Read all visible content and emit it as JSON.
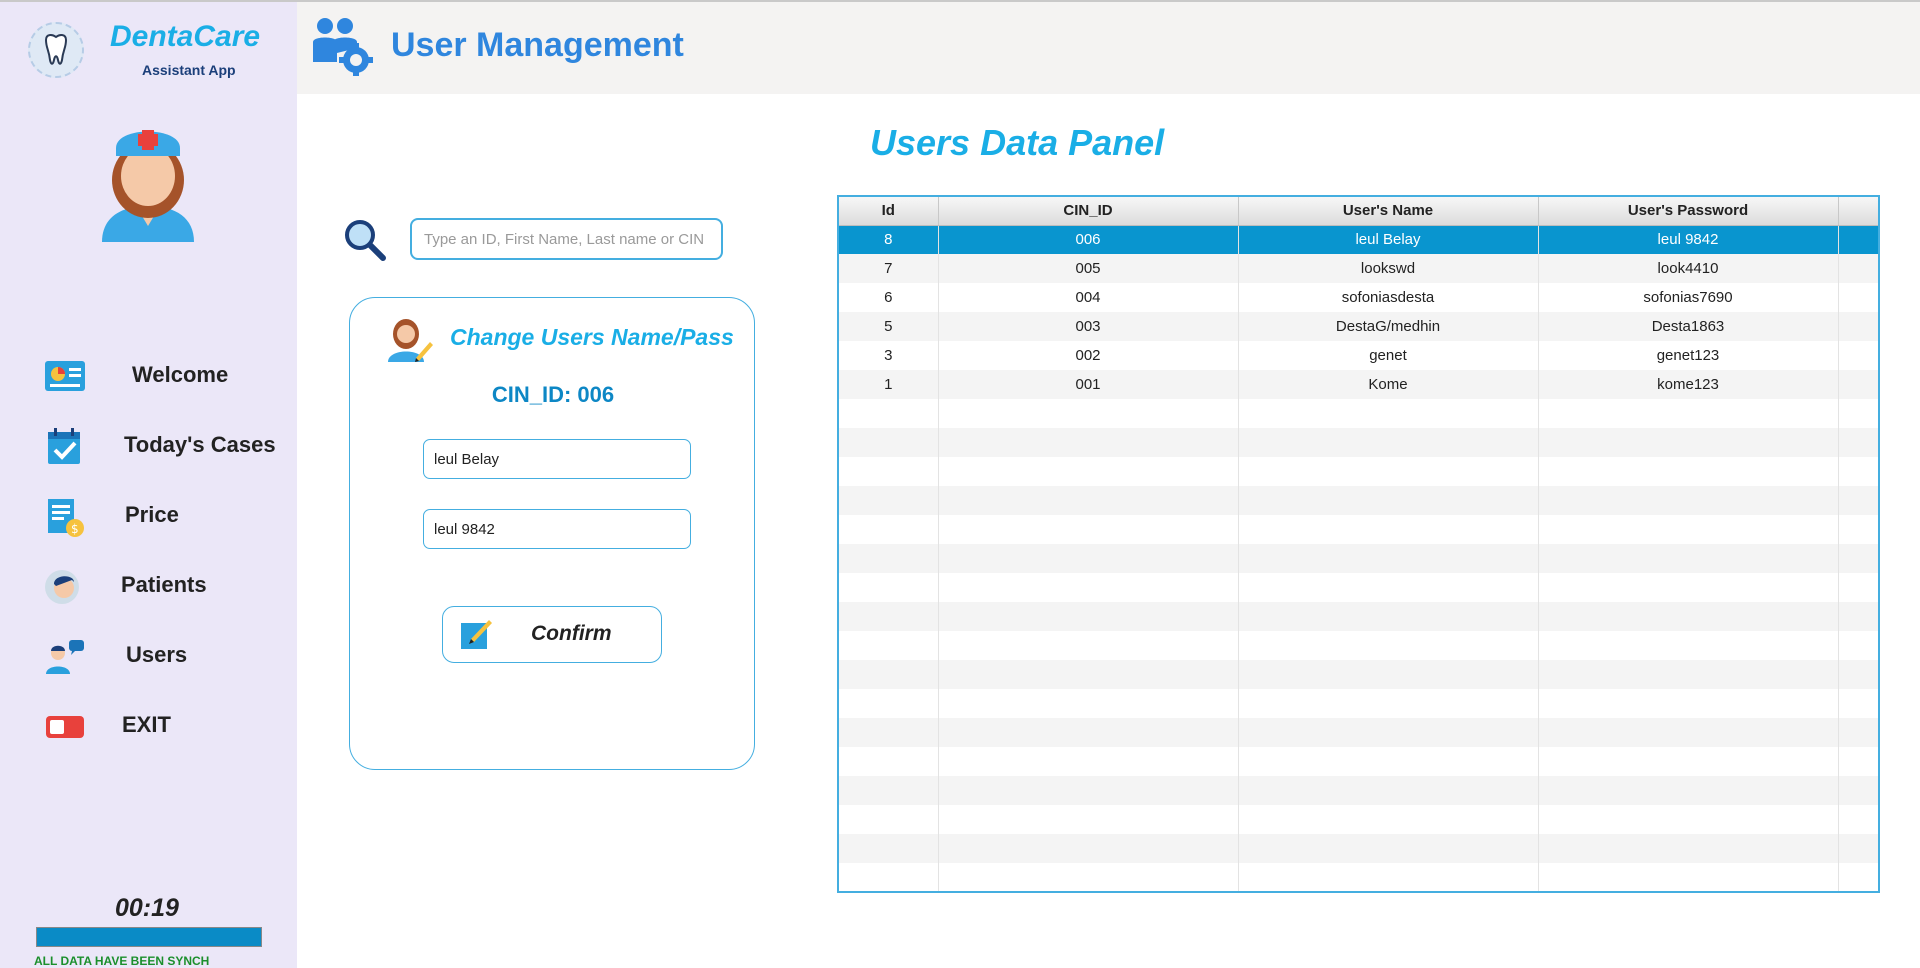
{
  "brand": {
    "name": "DentaCare",
    "subtitle": "Assistant App"
  },
  "nav": [
    {
      "label": "Welcome",
      "icon": "dashboard-icon"
    },
    {
      "label": "Today's Cases",
      "icon": "calendar-check-icon"
    },
    {
      "label": "Price",
      "icon": "invoice-icon"
    },
    {
      "label": "Patients",
      "icon": "patient-icon"
    },
    {
      "label": "Users",
      "icon": "user-chat-icon"
    },
    {
      "label": "EXIT",
      "icon": "toggle-exit-icon"
    }
  ],
  "status": {
    "timer": "00:19",
    "progress": 1.0,
    "sync_text": "ALL DATA HAVE BEEN SYNCH"
  },
  "header": {
    "title": "User Management",
    "icon": "users-gear-icon"
  },
  "panel": {
    "title": "Users Data Panel"
  },
  "search": {
    "placeholder": "Type an ID, First Name, Last name or CIN",
    "value": ""
  },
  "edit_card": {
    "title": "Change Users Name/Pass",
    "cin_label": "CIN_ID: 006",
    "name_value": "leul Belay",
    "password_value": "leul 9842",
    "confirm_label": "Confirm"
  },
  "table": {
    "columns": [
      "Id",
      "CIN_ID",
      "User's Name",
      "User's Password"
    ],
    "rows": [
      [
        "8",
        "006",
        "leul Belay",
        "leul 9842"
      ],
      [
        "7",
        "005",
        "lookswd",
        "look4410"
      ],
      [
        "6",
        "004",
        "sofoniasdesta",
        "sofonias7690"
      ],
      [
        "5",
        "003",
        "DestaG/medhin",
        "Desta1863"
      ],
      [
        "3",
        "002",
        "genet",
        "genet123"
      ],
      [
        "1",
        "001",
        "Kome",
        "kome123"
      ]
    ],
    "selected_index": 0
  },
  "colors": {
    "accent": "#1aaee6",
    "selected_row": "#0995cf",
    "sidebar_bg": "#ebe7f8",
    "header_title": "#2f86de",
    "sync_text": "#1b8f2c"
  }
}
